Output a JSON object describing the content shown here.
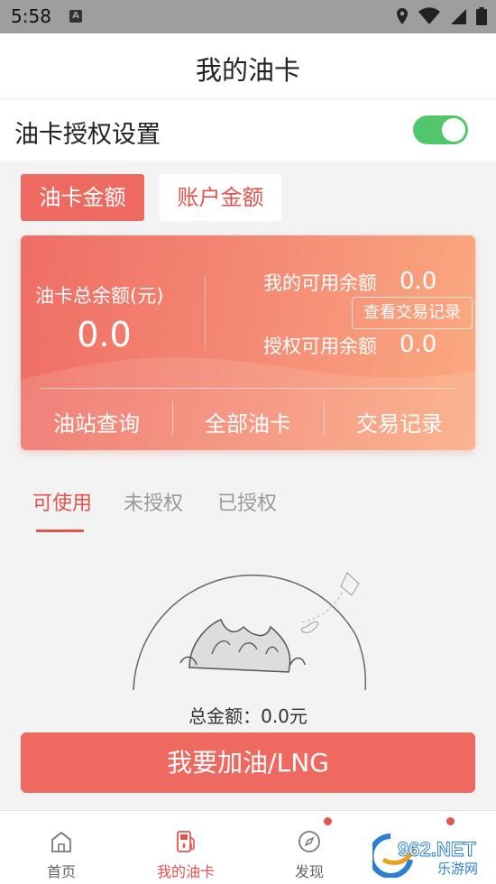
{
  "status_bar": {
    "time": "5:58",
    "a_badge": "A"
  },
  "header": {
    "title": "我的油卡"
  },
  "auth_setting": {
    "label": "油卡授权设置",
    "enabled": true
  },
  "tabs": {
    "active": "油卡金额",
    "inactive": "账户金额"
  },
  "balance_card": {
    "total_label": "油卡总余额(元)",
    "total_value": "0.0",
    "available_label": "我的可用余额",
    "available_value": "0.0",
    "transaction_link": "查看交易记录",
    "authorized_label": "授权可用余额",
    "authorized_value": "0.0",
    "actions": [
      "油站查询",
      "全部油卡",
      "交易记录"
    ]
  },
  "sub_tabs": [
    "可使用",
    "未授权",
    "已授权"
  ],
  "summary": {
    "total_amount": "总金额：0.0元"
  },
  "primary_button": "我要加油/LNG",
  "bottom_nav": [
    {
      "label": "首页",
      "icon": "home-icon"
    },
    {
      "label": "我的油卡",
      "icon": "fuel-pump-icon"
    },
    {
      "label": "发现",
      "icon": "compass-icon"
    }
  ],
  "watermark": {
    "text": "962.NET",
    "subtext": "乐游网"
  },
  "colors": {
    "accent": "#ee6a61",
    "toggle_on": "#52c66b",
    "status_bar": "#9e9e9e"
  }
}
